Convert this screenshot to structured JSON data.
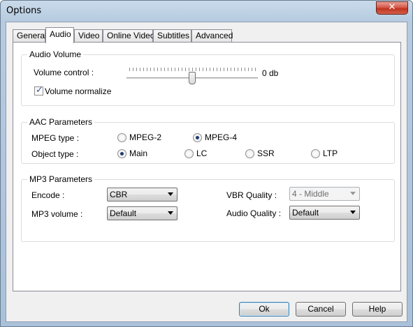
{
  "window": {
    "title": "Options",
    "close_glyph": "✕"
  },
  "tabs": [
    {
      "label": "General"
    },
    {
      "label": "Audio",
      "active": true
    },
    {
      "label": "Video"
    },
    {
      "label": "Online Video"
    },
    {
      "label": "Subtitles"
    },
    {
      "label": "Advanced"
    }
  ],
  "audio_volume": {
    "title": "Audio Volume",
    "volume_label": "Volume control :",
    "volume_value": "0 db",
    "normalize_label": "Volume normalize",
    "normalize_checked": true
  },
  "aac": {
    "title": "AAC Parameters",
    "mpeg_type_label": "MPEG type :",
    "mpeg_options": [
      "MPEG-2",
      "MPEG-4"
    ],
    "mpeg_selected": "MPEG-4",
    "object_type_label": "Object type :",
    "object_options": [
      "Main",
      "LC",
      "SSR",
      "LTP"
    ],
    "object_selected": "Main"
  },
  "mp3": {
    "title": "MP3 Parameters",
    "encode_label": "Encode :",
    "encode_value": "CBR",
    "vbr_label": "VBR Quality :",
    "vbr_value": "4 - Middle",
    "mp3_volume_label": "MP3 volume :",
    "mp3_volume_value": "Default",
    "audio_quality_label": "Audio Quality :",
    "audio_quality_value": "Default"
  },
  "buttons": {
    "ok": "Ok",
    "cancel": "Cancel",
    "help": "Help"
  }
}
